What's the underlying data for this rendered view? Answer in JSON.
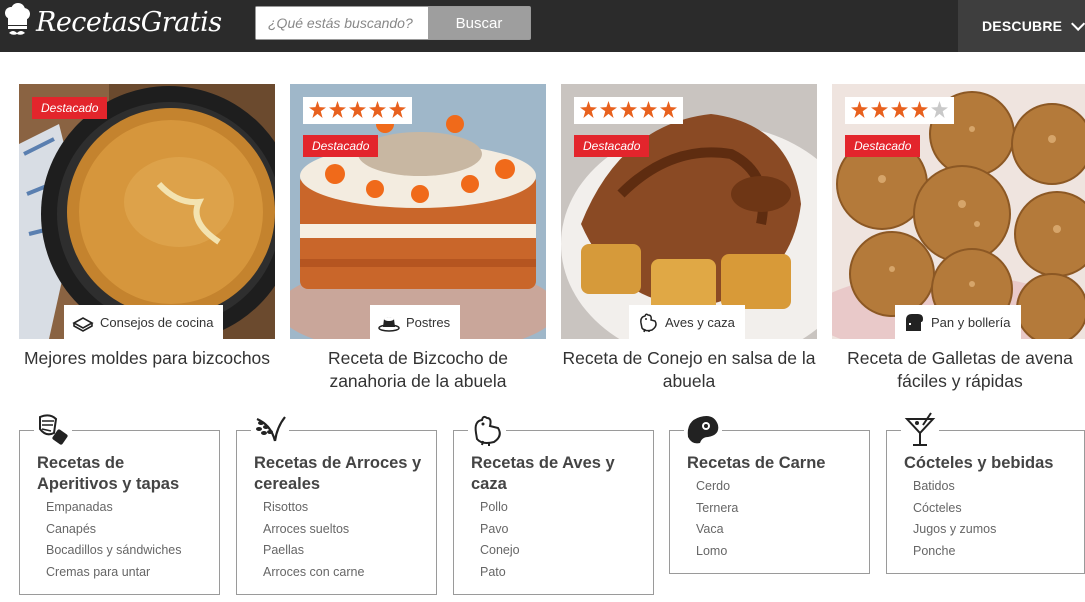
{
  "header": {
    "logo_text": "RecetasGratis",
    "search_placeholder": "¿Qué estás buscando?",
    "search_button": "Buscar",
    "discover_label": "DESCUBRE"
  },
  "colors": {
    "header_bg": "#2b2b2b",
    "badge_red": "#e3252c",
    "star_orange": "#e8611e"
  },
  "cards": [
    {
      "badge": "Destacado",
      "rating": 0,
      "category": "Consejos de cocina",
      "category_icon": "book-icon",
      "title": "Mejores moldes para bizcochos"
    },
    {
      "badge": "Destacado",
      "rating": 5,
      "category": "Postres",
      "category_icon": "pudding-icon",
      "title": "Receta de Bizcocho de zanahoria de la abuela"
    },
    {
      "badge": "Destacado",
      "rating": 5,
      "category": "Aves y caza",
      "category_icon": "chicken-icon",
      "title": "Receta de Conejo en salsa de la abuela"
    },
    {
      "badge": "Destacado",
      "rating": 4,
      "category": "Pan y bollería",
      "category_icon": "bread-icon",
      "title": "Receta de Galletas de avena fáciles y rápidas"
    }
  ],
  "categories": [
    {
      "icon": "appetizer-icon",
      "title": "Recetas de Aperitivos y tapas",
      "items": [
        "Empanadas",
        "Canapés",
        "Bocadillos y sándwiches",
        "Cremas para untar"
      ]
    },
    {
      "icon": "wheat-icon",
      "title": "Recetas de Arroces y cereales",
      "items": [
        "Risottos",
        "Arroces sueltos",
        "Paellas",
        "Arroces con carne"
      ]
    },
    {
      "icon": "chicken-icon",
      "title": "Recetas de Aves y caza",
      "items": [
        "Pollo",
        "Pavo",
        "Conejo",
        "Pato"
      ]
    },
    {
      "icon": "steak-icon",
      "title": "Recetas de Carne",
      "items": [
        "Cerdo",
        "Ternera",
        "Vaca",
        "Lomo"
      ]
    },
    {
      "icon": "cocktail-icon",
      "title": "Cócteles y bebidas",
      "items": [
        "Batidos",
        "Cócteles",
        "Jugos y zumos",
        "Ponche"
      ]
    }
  ]
}
